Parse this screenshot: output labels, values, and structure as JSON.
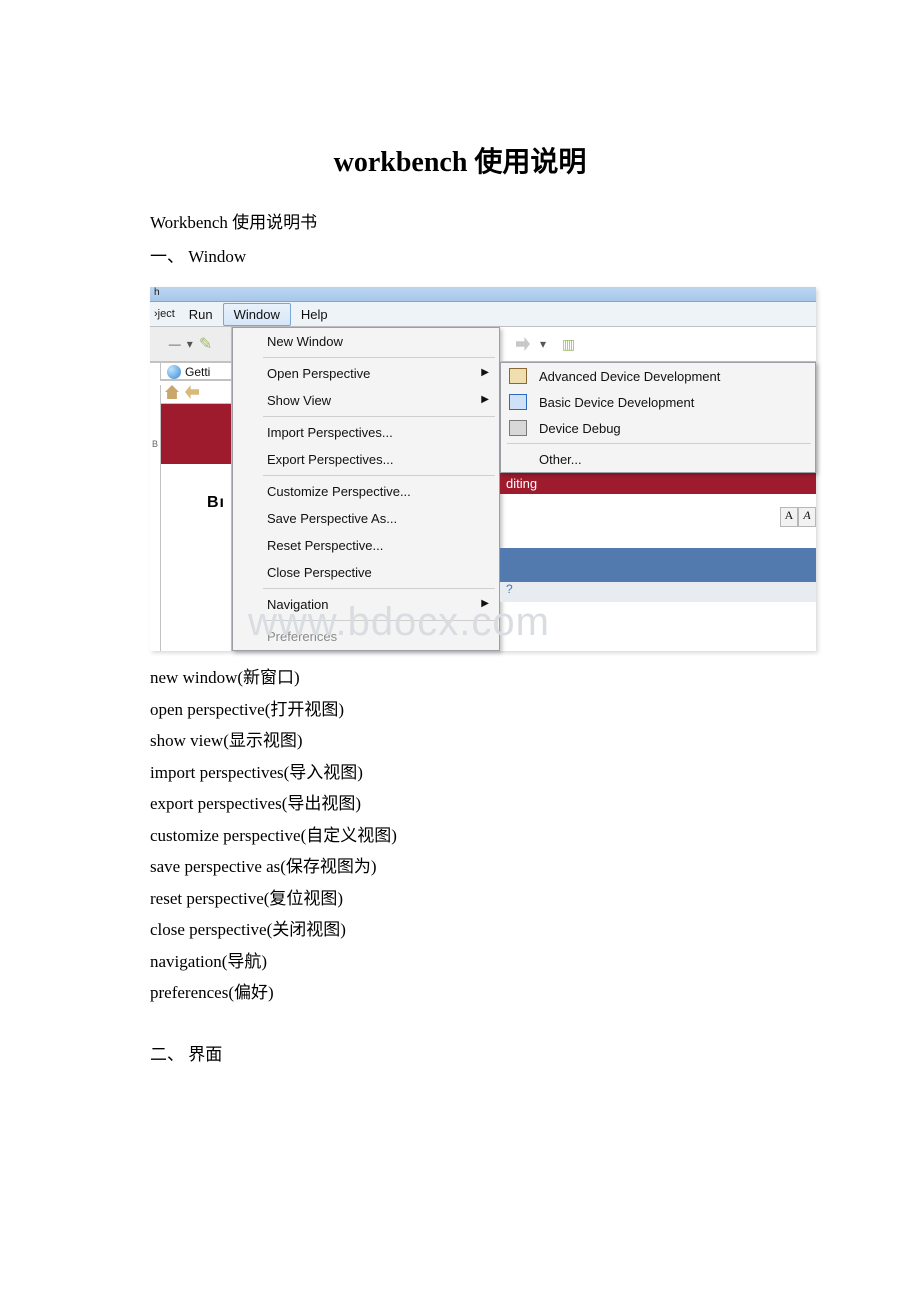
{
  "title": "workbench 使用说明",
  "subtitle": "Workbench 使用说明书",
  "section1": "一、 Window",
  "section2": "二、 界面",
  "titlebar_fragment": "h",
  "menubar": {
    "project": "›ject",
    "run": "Run",
    "window": "Window",
    "help": "Help"
  },
  "toolbar_left": {
    "dash": "—",
    "drop": "▾"
  },
  "tab_getti": "Getti",
  "gutter_label": "B",
  "big_B": "Bı",
  "right_toolbar": {
    "fwd": "⇨",
    "drop": "▾"
  },
  "window_menu": {
    "new_window": "New Window",
    "open_perspective": "Open Perspective",
    "show_view": "Show View",
    "import_perspectives": "Import Perspectives...",
    "export_perspectives": "Export Perspectives...",
    "customize_perspective": "Customize Perspective...",
    "save_perspective_as": "Save Perspective As...",
    "reset_perspective": "Reset Perspective...",
    "close_perspective": "Close Perspective",
    "navigation": "Navigation",
    "preferences": "Preferences"
  },
  "submenu": {
    "adv": "Advanced Device Development",
    "basic": "Basic Device Development",
    "debug": "Device Debug",
    "other": "Other..."
  },
  "editing_label": "diting",
  "badge_A1": "A",
  "badge_A2": "A",
  "bot_q": "?",
  "watermark": "www.bdocx.com",
  "glossary": [
    "new window(新窗口)",
    "open perspective(打开视图)",
    "show view(显示视图)",
    "import perspectives(导入视图)",
    "export perspectives(导出视图)",
    "customize perspective(自定义视图)",
    "save perspective as(保存视图为)",
    "reset perspective(复位视图)",
    "close perspective(关闭视图)",
    "navigation(导航)",
    "preferences(偏好)"
  ]
}
